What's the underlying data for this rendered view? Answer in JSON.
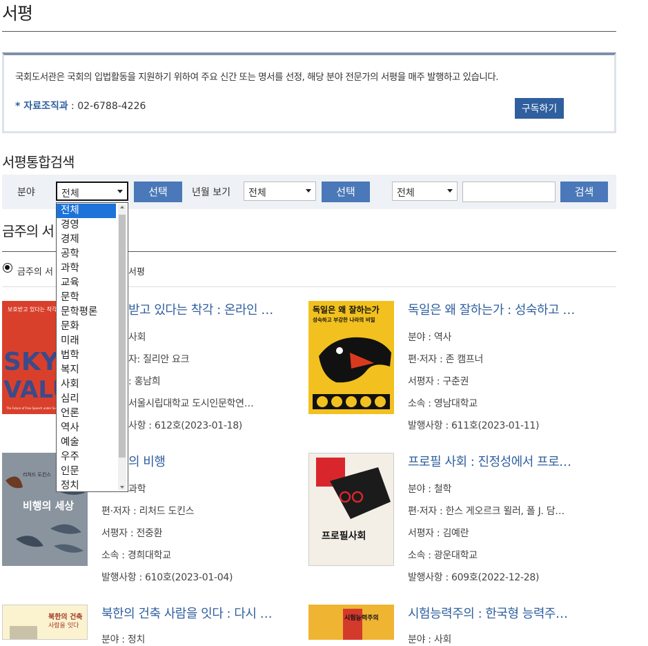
{
  "page": {
    "title": "서평"
  },
  "info": {
    "text": "국회도서관은 국회의 입법활동을 지원하기 위하여 주요 신간 또는 명서를 선정, 해당 분야 전문가의 서평을 매주 발행하고 있습니다.",
    "contact_label": "* 자료조직과",
    "contact_value": " : 02-6788-4226",
    "subscribe": "구독하기"
  },
  "search": {
    "section_title": "서평통합검색",
    "field_label": "분야",
    "field_value": "전체",
    "select_button": "선택",
    "period_label": "년월 보기",
    "period_value": "전체",
    "select_button2": "선택",
    "type_value": "전체",
    "query": "",
    "search_button": "검색"
  },
  "dropdown": {
    "options": [
      "전체",
      "경영",
      "경제",
      "공학",
      "과학",
      "교육",
      "문학",
      "문학평론",
      "문화",
      "미래",
      "법학",
      "복지",
      "사회",
      "심리",
      "언론",
      "역사",
      "예술",
      "우주",
      "인문",
      "정치"
    ],
    "selected": "전체"
  },
  "weekly": {
    "title": "금주의 서",
    "radio_label": "금주의 서",
    "radio_label2": "서평"
  },
  "books": [
    {
      "title": "받고 있다는 착각 : 온라인 …",
      "field": "사회",
      "author": "자: 질리안 요크",
      "reviewer": ": 홍남희",
      "affiliation": "서울시립대학교 도시인문학연…",
      "issue": "사항 : 612호(2023-01-18)"
    },
    {
      "title": "독일은 왜 잘하는가 : 성숙하고 …",
      "field": "분야 : 역사",
      "author": "편·저자 : 존 캠프너",
      "reviewer": "서평자 : 구춘권",
      "affiliation": "소속 : 영남대학교",
      "issue": "발행사항 : 611호(2023-01-11)"
    },
    {
      "title": "의 비행",
      "field": "과학",
      "author": "편·저자 : 리처드 도킨스",
      "reviewer": "서평자 : 전중환",
      "affiliation": "소속 : 경희대학교",
      "issue": "발행사항 : 610호(2023-01-04)"
    },
    {
      "title": "프로필 사회 : 진정성에서 프로…",
      "field": "분야 : 철학",
      "author": "편·저자 : 한스 게오르크 묄러, 폴 J. 담…",
      "reviewer": "서평자 : 김예란",
      "affiliation": "소속 : 광운대학교",
      "issue": "발행사항 : 609호(2022-12-28)"
    },
    {
      "title": "북한의 건축 사람을 잇다 : 다시 …",
      "field": "분야 : 정치",
      "author": "",
      "reviewer": "",
      "affiliation": "",
      "issue": ""
    },
    {
      "title": "시험능력주의 : 한국형 능력주…",
      "field": "분야 : 사회",
      "author": "",
      "reviewer": "",
      "affiliation": "",
      "issue": ""
    }
  ],
  "covers": {
    "c1": {
      "top_text": "보호받고 있다는 착각",
      "big": "SKY",
      "big2": "VALU",
      "sub": "The Future of Free Speech under Surveillance Capitalism"
    },
    "c2": {
      "line1": "독일은 왜 잘하는가",
      "line2": "성숙하고 부강한 나라의 비밀"
    },
    "c3": {
      "author": "리처드 도킨스",
      "title": "비행의 세상"
    },
    "c4": {
      "title": "프로필사회"
    },
    "c5": {
      "title": "북한의 건축",
      "sub": "사람을 잇다"
    },
    "c6": {
      "title": "시험능력주의"
    }
  },
  "colors": {
    "accent": "#2f5f9e",
    "button": "#4a78b8",
    "selected": "#1e73d9"
  }
}
